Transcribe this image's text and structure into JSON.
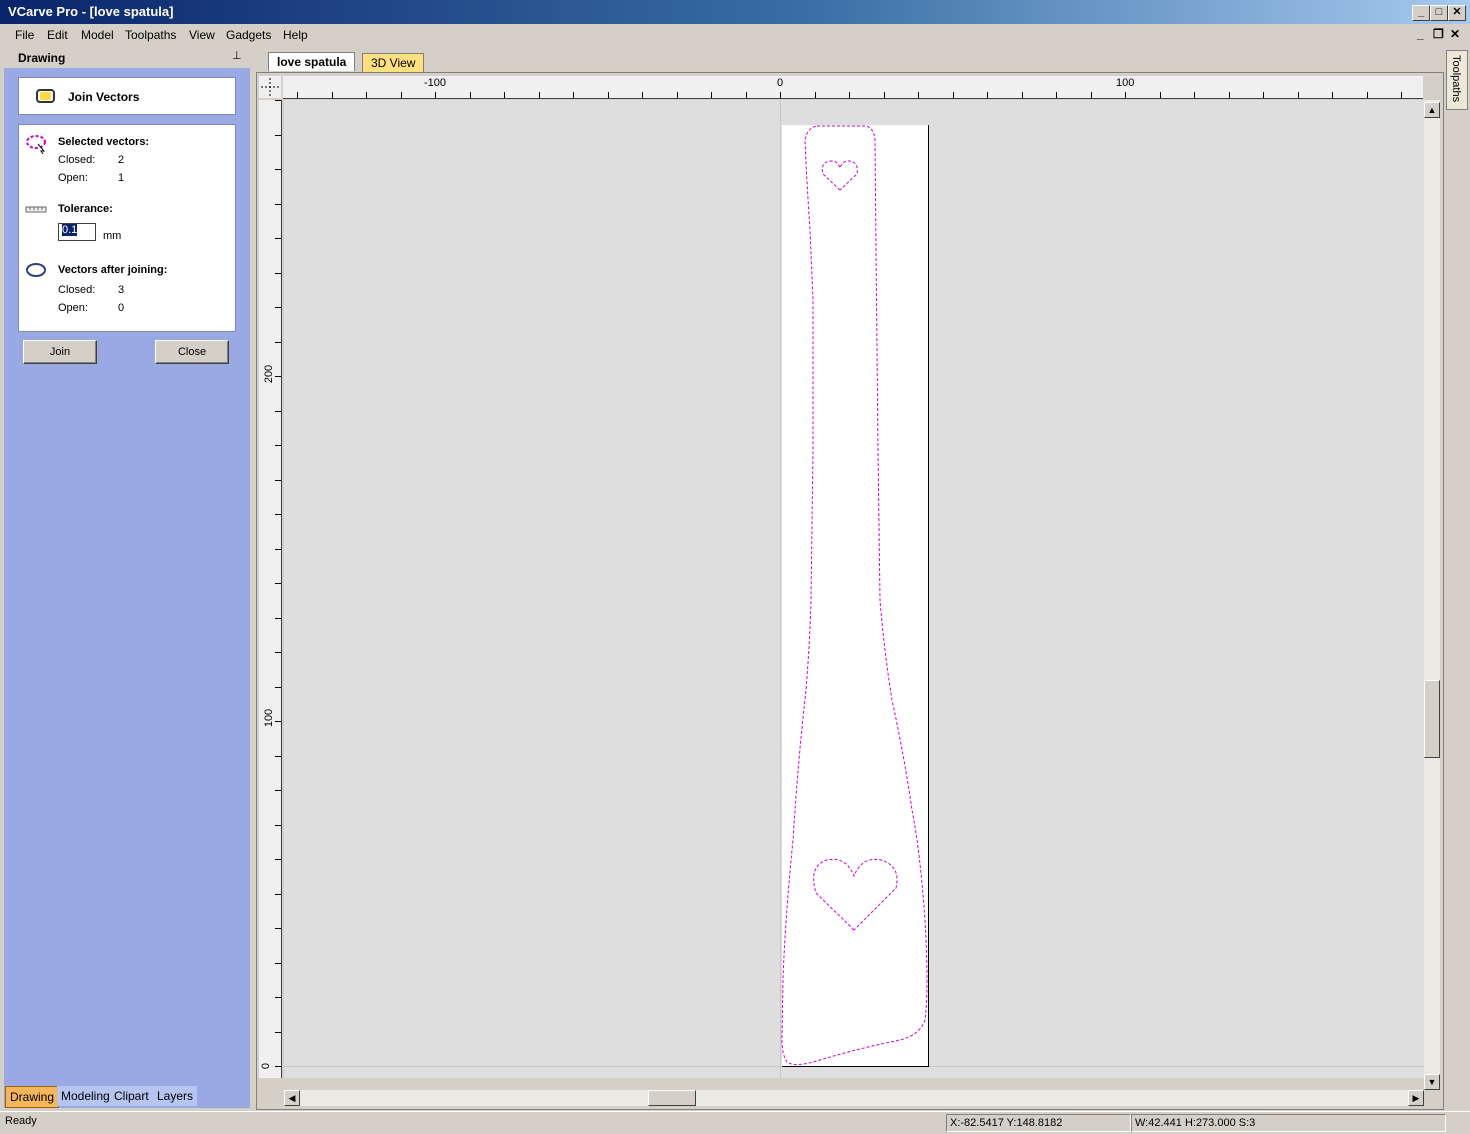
{
  "window": {
    "title": "VCarve Pro                              - [love spatula]",
    "minimize": "_",
    "maximize": "□",
    "close": "✕"
  },
  "menu": [
    "File",
    "Edit",
    "Model",
    "Toolpaths",
    "View",
    "Gadgets",
    "Help"
  ],
  "mdi": {
    "minimize": "_",
    "restore": "❐",
    "close": "✕"
  },
  "panel": {
    "header": "Drawing",
    "pin": "⊥",
    "tool_title": "Join Vectors",
    "selected_heading": "Selected vectors:",
    "selected_closed_label": "Closed:",
    "selected_closed_value": "2",
    "selected_open_label": "Open:",
    "selected_open_value": "1",
    "tolerance_heading": "Tolerance:",
    "tolerance_value": "0.1",
    "tolerance_unit": "mm",
    "after_heading": "Vectors after joining:",
    "after_closed_label": "Closed:",
    "after_closed_value": "3",
    "after_open_label": "Open:",
    "after_open_value": "0",
    "join_button": "Join",
    "close_button": "Close"
  },
  "bottom_tabs": [
    "Drawing",
    "Modeling",
    "Clipart",
    "Layers"
  ],
  "doc_tabs": [
    "love spatula",
    "3D View"
  ],
  "right_tab": "Toolpaths",
  "rulers": {
    "h_labels": [
      "-100",
      "0",
      "100"
    ],
    "v_labels": [
      "200",
      "100",
      "0"
    ]
  },
  "status": {
    "ready": "Ready",
    "coords": "X:-82.5417 Y:148.8182",
    "dims": "W:42.441   H:273.000  S:3"
  },
  "colors": {
    "vector_selected": "#cc00cc",
    "panel_bg": "#9aa8e4",
    "title_bar": "#0a246a"
  }
}
